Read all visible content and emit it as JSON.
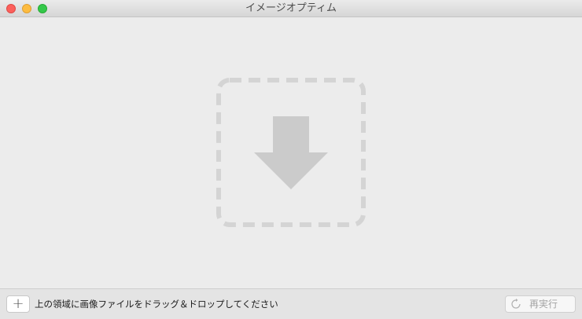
{
  "window": {
    "title": "イメージオプティム"
  },
  "drop_zone": {
    "icon": "download-arrow-icon",
    "border_color": "#d4d4d4",
    "arrow_color": "#cbcbcb"
  },
  "footer": {
    "add_label": "+",
    "status_text": "上の領域に画像ファイルをドラッグ＆ドロップしてください",
    "rerun_label": "再実行",
    "rerun_icon": "refresh-icon"
  },
  "colors": {
    "close": "#fc605c",
    "minimize": "#fdbc40",
    "zoom": "#34c84a"
  }
}
